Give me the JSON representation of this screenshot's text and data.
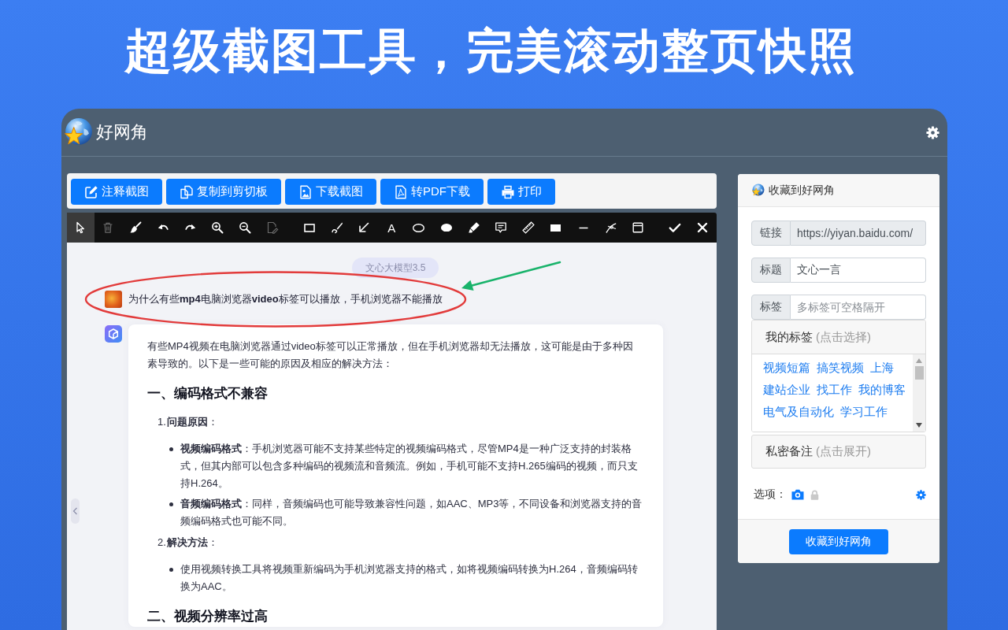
{
  "headline": "超级截图工具，完美滚动整页快照",
  "window": {
    "title": "好网角"
  },
  "actions": [
    {
      "kind": "annotate",
      "label": "注释截图"
    },
    {
      "kind": "copy",
      "label": "复制到剪切板"
    },
    {
      "kind": "download",
      "label": "下载截图"
    },
    {
      "kind": "pdf",
      "label": "转PDF下载"
    },
    {
      "kind": "print",
      "label": "打印"
    }
  ],
  "toolbar": {
    "groups": [
      [
        {
          "kind": "select",
          "selected": true,
          "disabled": false
        },
        {
          "kind": "delete",
          "selected": false,
          "disabled": true
        },
        {
          "kind": "clear",
          "selected": false,
          "disabled": false
        },
        {
          "kind": "undo",
          "selected": false,
          "disabled": false
        },
        {
          "kind": "redo",
          "selected": false,
          "disabled": false
        },
        {
          "kind": "zoom-in",
          "selected": false,
          "disabled": false
        },
        {
          "kind": "zoom-out",
          "selected": false,
          "disabled": false
        },
        {
          "kind": "edit-doc",
          "selected": false,
          "disabled": true
        }
      ],
      [
        {
          "kind": "rectangle",
          "selected": false,
          "disabled": false
        },
        {
          "kind": "brush",
          "selected": false,
          "disabled": false
        },
        {
          "kind": "arrow",
          "selected": false,
          "disabled": false
        },
        {
          "kind": "text",
          "glyph": "A",
          "selected": false,
          "disabled": false
        },
        {
          "kind": "ellipse",
          "selected": false,
          "disabled": false
        },
        {
          "kind": "filled-ellipse",
          "selected": false,
          "disabled": false
        },
        {
          "kind": "highlighter",
          "selected": false,
          "disabled": false
        },
        {
          "kind": "comment",
          "selected": false,
          "disabled": false
        },
        {
          "kind": "ruler",
          "selected": false,
          "disabled": false
        },
        {
          "kind": "filled-rectangle",
          "selected": false,
          "disabled": false
        },
        {
          "kind": "line",
          "selected": false,
          "disabled": false
        },
        {
          "kind": "curve",
          "selected": false,
          "disabled": false
        },
        {
          "kind": "frame",
          "selected": false,
          "disabled": false
        }
      ],
      [
        {
          "kind": "confirm",
          "selected": false,
          "disabled": false
        },
        {
          "kind": "cancel",
          "selected": false,
          "disabled": false
        }
      ]
    ]
  },
  "chat": {
    "model_badge": "文心大模型3.5",
    "question": "为什么有些**mp4**电脑浏览器**video**标签可以播放，手机浏览器不能播放",
    "answer": [
      {
        "kind": "paragraph",
        "text": "有些MP4视频在电脑浏览器通过video标签可以正常播放，但在手机浏览器却无法播放，这可能是由于多种因素导致的。以下是一些可能的原因及相应的解决方法："
      },
      {
        "kind": "heading",
        "text": "一、编码格式不兼容"
      },
      {
        "kind": "numbered",
        "number": "1.",
        "text": "**问题原因**：",
        "items": [
          "**视频编码格式**：手机浏览器可能不支持某些特定的视频编码格式，尽管MP4是一种广泛支持的封装格式，但其内部可以包含多种编码的视频流和音频流。例如，手机可能不支持H.265编码的视频，而只支持H.264。",
          "**音频编码格式**：同样，音频编码也可能导致兼容性问题，如AAC、MP3等，不同设备和浏览器支持的音频编码格式也可能不同。"
        ]
      },
      {
        "kind": "numbered",
        "number": "2.",
        "text": "**解决方法**：",
        "items": [
          "使用视频转换工具将视频重新编码为手机浏览器支持的格式，如将视频编码转换为H.264，音频编码转换为AAC。"
        ]
      },
      {
        "kind": "heading",
        "text": "二、视频分辨率过高"
      }
    ],
    "annotations": [
      {
        "kind": "ellipse"
      },
      {
        "kind": "arrow"
      }
    ]
  },
  "bookmark_panel": {
    "title": "收藏到好网角",
    "fields": [
      {
        "label": "链接",
        "value": "https://yiyan.baidu.com/",
        "readonly": true
      },
      {
        "label": "标题",
        "value": "文心一言",
        "readonly": false
      },
      {
        "label": "标签",
        "placeholder": "多标签可空格隔开",
        "readonly": false
      }
    ],
    "my_tags": {
      "label": "我的标签",
      "hint": "(点击选择)",
      "tags": [
        "视频短篇",
        "搞笑视频",
        "上海",
        "建站企业",
        "找工作",
        "我的博客",
        "电气及自动化",
        "学习工作"
      ]
    },
    "private_note": {
      "label": "私密备注",
      "hint": "(点击展开)"
    },
    "options": {
      "label": "选项：",
      "toggles": [
        {
          "kind": "camera",
          "on": true
        },
        {
          "kind": "lock",
          "on": false
        }
      ]
    },
    "submit": "收藏到好网角"
  }
}
